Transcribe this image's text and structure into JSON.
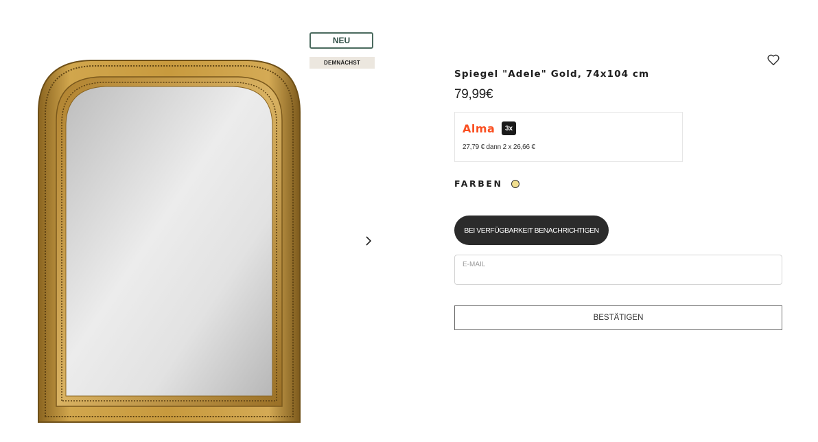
{
  "badges": {
    "new": "NEU",
    "soon": "DEMNÄCHST"
  },
  "product": {
    "title": "Spiegel \"Adele\" Gold, 74x104 cm",
    "price": "79,99€"
  },
  "alma": {
    "logo": "Alma",
    "installments": "3x",
    "text": "27,79 € dann 2 x 26,66 €",
    "brand_color": "#fa5022"
  },
  "colors": {
    "label": "FARBEN",
    "swatch": "#f1df8f"
  },
  "notify_button": "BEI VERFÜGBARKEIT BENACHRICHTIGEN",
  "email": {
    "label": "E-MAIL"
  },
  "confirm_button": "BESTÄTIGEN",
  "icons": {
    "wishlist": "heart-icon",
    "next": "chevron-right-icon"
  }
}
